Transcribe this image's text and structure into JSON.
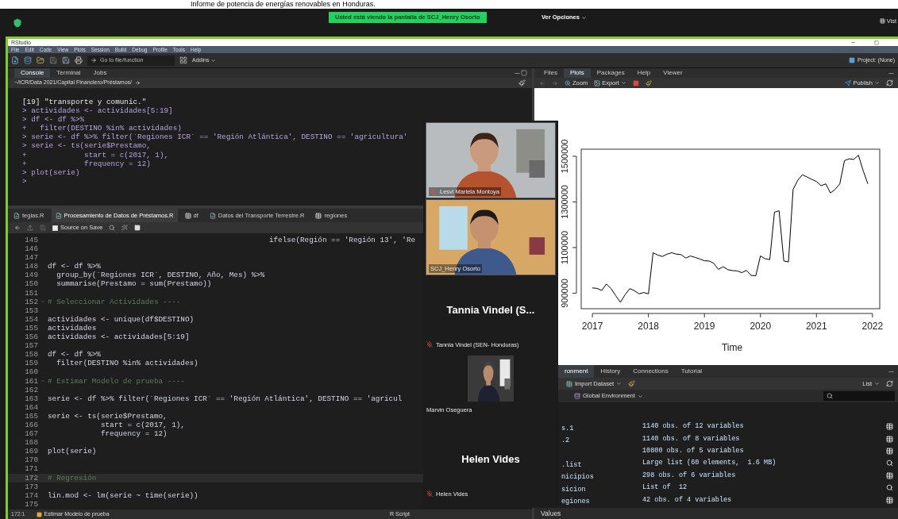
{
  "top_caption": "Informe de potencia de energías renovables en Honduras.",
  "meeting_bar": {
    "banner": "Usted está viendo la pantalla de SCJ_Henry Osorto",
    "options_button": "Ver Opciones",
    "view_button": "Vist"
  },
  "window": {
    "title": "RStudio",
    "menu": [
      "File",
      "Edit",
      "Code",
      "View",
      "Plots",
      "Session",
      "Build",
      "Debug",
      "Profile",
      "Tools",
      "Help"
    ],
    "goto_placeholder": "Go to file/function",
    "addins": "Addins",
    "project": "Project: (None)"
  },
  "console": {
    "tabs": [
      {
        "label": "Console",
        "selected": true
      },
      {
        "label": "Terminal",
        "selected": false
      },
      {
        "label": "Jobs",
        "selected": false
      }
    ],
    "path": "~/ICR/Data 2021/Capital Financiero/Préstamos/",
    "lines": [
      {
        "kind": "output",
        "text": "[19] \"transporte y comunic.\""
      },
      {
        "kind": "command",
        "text": "> actividades <- actividades[5:19]"
      },
      {
        "kind": "command",
        "text": "> df <- df %>%"
      },
      {
        "kind": "command",
        "text": "+   filter(DESTINO %in% actividades)"
      },
      {
        "kind": "command",
        "text": "> serie <- df %>% filter(`Regiones ICR` == 'Región Atlántica', DESTINO == 'agricultura'"
      },
      {
        "kind": "command",
        "text": "> serie <- ts(serie$Prestamo,"
      },
      {
        "kind": "command",
        "text": "+             start = c(2017, 1),"
      },
      {
        "kind": "command",
        "text": "+             frequency = 12)"
      },
      {
        "kind": "command",
        "text": "> plot(serie)"
      },
      {
        "kind": "command",
        "text": ">"
      }
    ]
  },
  "source": {
    "tabs": [
      {
        "label": "tegias.R",
        "kind": "script",
        "selected": false
      },
      {
        "label": "Procesamiento de Datos de Préstamos.R",
        "kind": "script",
        "selected": true
      },
      {
        "label": "df",
        "kind": "data",
        "selected": false
      },
      {
        "label": "Datos del Transporte Terrestre.R",
        "kind": "script",
        "selected": false
      },
      {
        "label": "regiones",
        "kind": "data",
        "selected": false
      }
    ],
    "source_on_save": {
      "label": "Source on Save",
      "checked": false
    },
    "lines": [
      {
        "number": "145",
        "kind": "code",
        "current": false,
        "text": "                                                  ifelse(Región == 'Región 13', 'Re"
      },
      {
        "number": "146",
        "kind": "code",
        "current": false
      },
      {
        "number": "147",
        "kind": "code",
        "current": false
      },
      {
        "number": "148",
        "kind": "code",
        "current": false,
        "text": "df <- df %>%"
      },
      {
        "number": "149",
        "kind": "code",
        "current": false,
        "text": "  group_by(`Regiones ICR`, DESTINO, Año, Mes) %>%"
      },
      {
        "number": "150",
        "kind": "code",
        "current": false,
        "text": "  summarise(Prestamo = sum(Prestamo))"
      },
      {
        "number": "151",
        "kind": "code",
        "current": false
      },
      {
        "number": "152",
        "kind": "section",
        "current": false,
        "text": "# Seleccionar Actividades ----"
      },
      {
        "number": "153",
        "kind": "code",
        "current": false
      },
      {
        "number": "154",
        "kind": "code",
        "current": false,
        "text": "actividades <- unique(df$DESTINO)"
      },
      {
        "number": "155",
        "kind": "code",
        "current": false,
        "text": "actividades"
      },
      {
        "number": "156",
        "kind": "code",
        "current": false,
        "text": "actividades <- actividades[5:19]"
      },
      {
        "number": "157",
        "kind": "code",
        "current": false
      },
      {
        "number": "158",
        "kind": "code",
        "current": false,
        "text": "df <- df %>%"
      },
      {
        "number": "159",
        "kind": "code",
        "current": false,
        "text": "  filter(DESTINO %in% actividades)"
      },
      {
        "number": "160",
        "kind": "code",
        "current": false
      },
      {
        "number": "161",
        "kind": "section",
        "current": false,
        "text": "# Estimar Modelo de prueba ----"
      },
      {
        "number": "162",
        "kind": "code",
        "current": false
      },
      {
        "number": "163",
        "kind": "code",
        "current": false,
        "text": "serie <- df %>% filter(`Regiones ICR` == 'Región Atlántica', DESTINO == 'agricul"
      },
      {
        "number": "164",
        "kind": "code",
        "current": false
      },
      {
        "number": "165",
        "kind": "code",
        "current": false,
        "text": "serie <- ts(serie$Prestamo,"
      },
      {
        "number": "166",
        "kind": "code",
        "current": false,
        "text": "            start = c(2017, 1),"
      },
      {
        "number": "167",
        "kind": "code",
        "current": false,
        "text": "            frequency = 12)"
      },
      {
        "number": "168",
        "kind": "code",
        "current": false
      },
      {
        "number": "169",
        "kind": "code",
        "current": false,
        "text": "plot(serie)"
      },
      {
        "number": "170",
        "kind": "code",
        "current": false
      },
      {
        "number": "171",
        "kind": "code",
        "current": false
      },
      {
        "number": "172",
        "kind": "comment",
        "current": true,
        "text": "# Regresión"
      },
      {
        "number": "173",
        "kind": "code",
        "current": false
      },
      {
        "number": "174",
        "kind": "code",
        "current": false,
        "text": "lin.mod <- lm(serie ~ time(serie))"
      },
      {
        "number": "175",
        "kind": "code",
        "current": false
      }
    ],
    "status": {
      "position": "172:1",
      "section": "Estimar Modelo de prueba",
      "file_type": "R Script"
    }
  },
  "plots": {
    "tabs": [
      {
        "label": "Files",
        "selected": false
      },
      {
        "label": "Plots",
        "selected": true
      },
      {
        "label": "Packages",
        "selected": false
      },
      {
        "label": "Help",
        "selected": false
      },
      {
        "label": "Viewer",
        "selected": false
      }
    ],
    "zoom": "Zoom",
    "export": "Export",
    "publish": "Publish",
    "chart_data": {
      "type": "line",
      "xlabel": "Time",
      "xlim": [
        2016.8,
        2022.13
      ],
      "ylim": [
        832000,
        1531000
      ],
      "xticks": [
        2017,
        2018,
        2019,
        2020,
        2021,
        2022
      ],
      "yticks": [
        900000,
        1100000,
        1300000,
        1500000
      ],
      "x": [
        2017,
        2017.083,
        2017.167,
        2017.25,
        2017.333,
        2017.417,
        2017.5,
        2017.583,
        2017.667,
        2017.75,
        2017.833,
        2017.917,
        2018,
        2018.083,
        2018.167,
        2018.25,
        2018.333,
        2018.417,
        2018.5,
        2018.583,
        2018.667,
        2018.75,
        2018.833,
        2018.917,
        2019,
        2019.083,
        2019.167,
        2019.25,
        2019.333,
        2019.417,
        2019.5,
        2019.583,
        2019.667,
        2019.75,
        2019.833,
        2019.917,
        2020,
        2020.083,
        2020.167,
        2020.25,
        2020.333,
        2020.417,
        2020.5,
        2020.583,
        2020.667,
        2020.75,
        2020.833,
        2020.917,
        2021,
        2021.083,
        2021.167,
        2021.25,
        2021.333,
        2021.417,
        2021.5,
        2021.583,
        2021.667,
        2021.75,
        2021.833,
        2021.917
      ],
      "series": [
        {
          "color": "#000000",
          "values": [
            923000,
            921000,
            912000,
            940000,
            920000,
            889000,
            860000,
            893000,
            920000,
            911000,
            897000,
            903000,
            897000,
            1077000,
            1067000,
            1061000,
            1071000,
            1077000,
            1071000,
            1069000,
            1054000,
            1063000,
            1057000,
            1050000,
            1042000,
            1041000,
            1031000,
            1004000,
            1016000,
            1003000,
            999000,
            998000,
            990000,
            1000000,
            978000,
            976000,
            1063000,
            1051000,
            1047000,
            1255000,
            1261000,
            1041000,
            1037000,
            1355000,
            1395000,
            1419000,
            1409000,
            1399000,
            1389000,
            1371000,
            1379000,
            1339000,
            1355000,
            1379000,
            1481000,
            1489000,
            1486000,
            1505000,
            1438000,
            1379000
          ]
        }
      ]
    }
  },
  "environment": {
    "tabs": [
      {
        "label": "ronment",
        "selected": true
      },
      {
        "label": "History",
        "selected": false
      },
      {
        "label": "Connections",
        "selected": false
      },
      {
        "label": "Tutorial",
        "selected": false
      }
    ],
    "import": "Import Dataset",
    "scope": "Global Environment",
    "view": "List",
    "rows": [
      {
        "name": "s.1",
        "value": "1140 obs. of 12 variables",
        "kind": "data"
      },
      {
        "name": ".2",
        "value": "1140 obs. of 8 variables",
        "kind": "data"
      },
      {
        "value": "10800 obs. of 5 variables",
        "kind": "data"
      },
      {
        "name": ".list",
        "value": "Large list (60 elements,  1.6 MB)",
        "kind": "list"
      },
      {
        "name": "nicipios",
        "value": "298 obs. of 6 variables",
        "kind": "data"
      },
      {
        "name": "sicion",
        "value": "List of  12",
        "kind": "list"
      },
      {
        "name": "egiones",
        "value": "42 obs. of 4 variables",
        "kind": "data"
      }
    ],
    "values_header": "Values"
  },
  "participants": [
    {
      "kind": "video",
      "name": "Lesvi Mariela Montoya",
      "muted": true
    },
    {
      "kind": "video",
      "name": "SCJ_Henry Osorto",
      "muted": false
    },
    {
      "kind": "name",
      "title": "Tannia Vindel (S...",
      "name": "Tannia Vindel (SEN- Honduras)",
      "muted": true
    },
    {
      "kind": "thumb",
      "name": "Marvin Oseguera",
      "muted": false
    },
    {
      "kind": "name",
      "title": "Helen Vides",
      "name": "Helen Vides",
      "muted": true
    }
  ]
}
